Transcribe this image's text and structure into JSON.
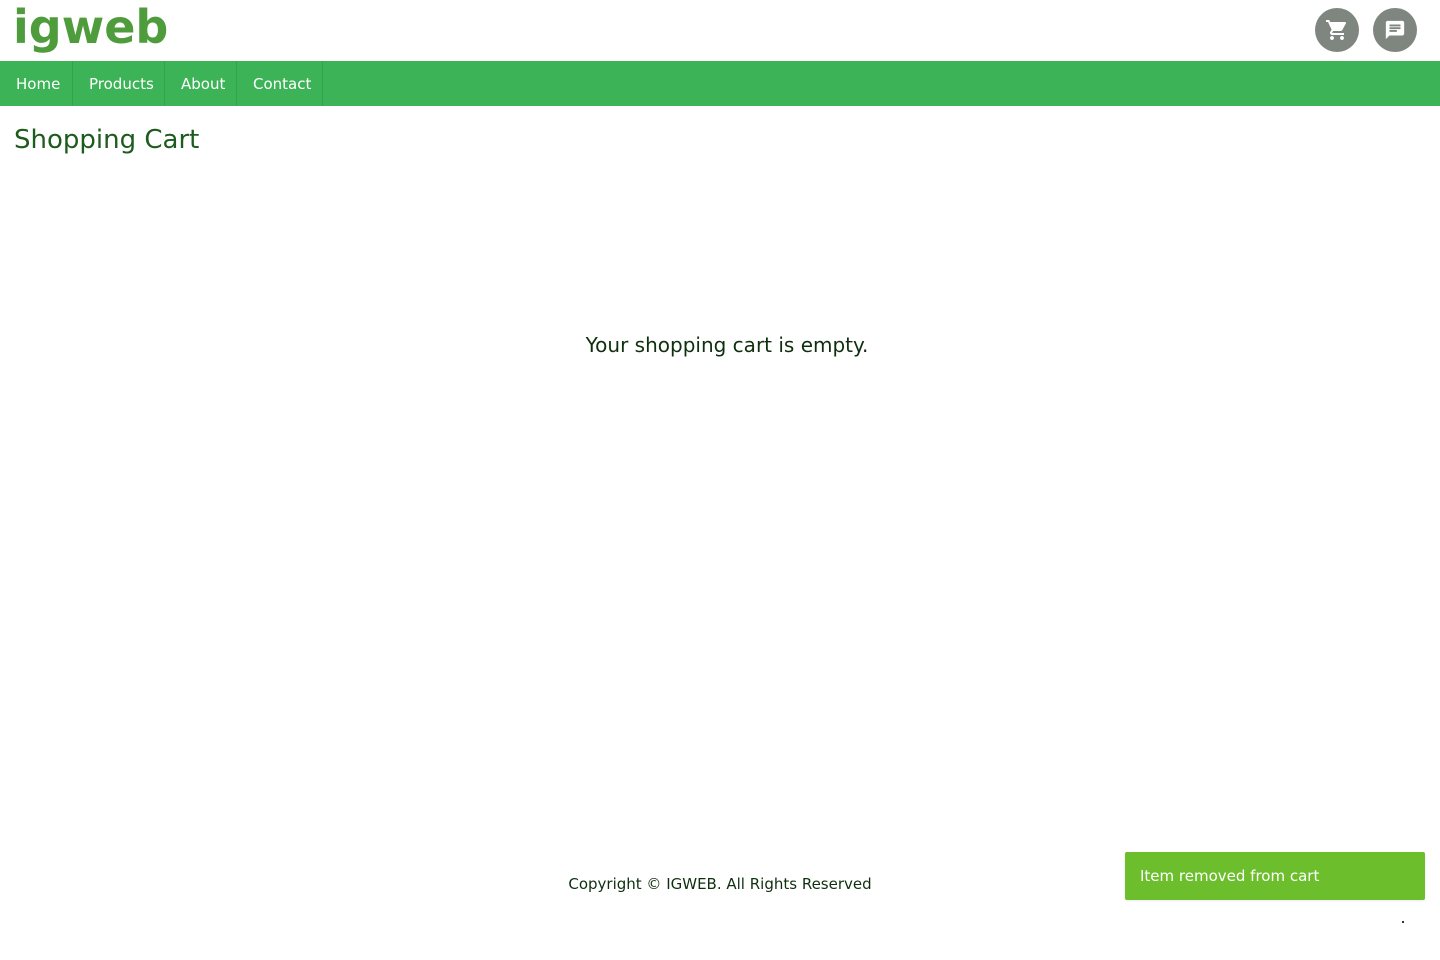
{
  "header": {
    "logo_text": "igweb",
    "icons": [
      {
        "name": "shopping-cart-icon"
      },
      {
        "name": "chat-icon"
      }
    ]
  },
  "nav": {
    "items": [
      {
        "label": "Home"
      },
      {
        "label": "Products"
      },
      {
        "label": "About"
      },
      {
        "label": "Contact"
      }
    ]
  },
  "page": {
    "title": "Shopping Cart",
    "empty_message": "Your shopping cart is empty."
  },
  "footer": {
    "copyright": "Copyright © IGWEB. All Rights Reserved"
  },
  "toast": {
    "message": "Item removed from cart"
  },
  "colors": {
    "brand_green": "#4e9c3c",
    "nav_green": "#3cb356",
    "toast_green": "#6cbe2d",
    "icon_gray": "#7f857f",
    "title_dark_green": "#1d5c1d"
  }
}
